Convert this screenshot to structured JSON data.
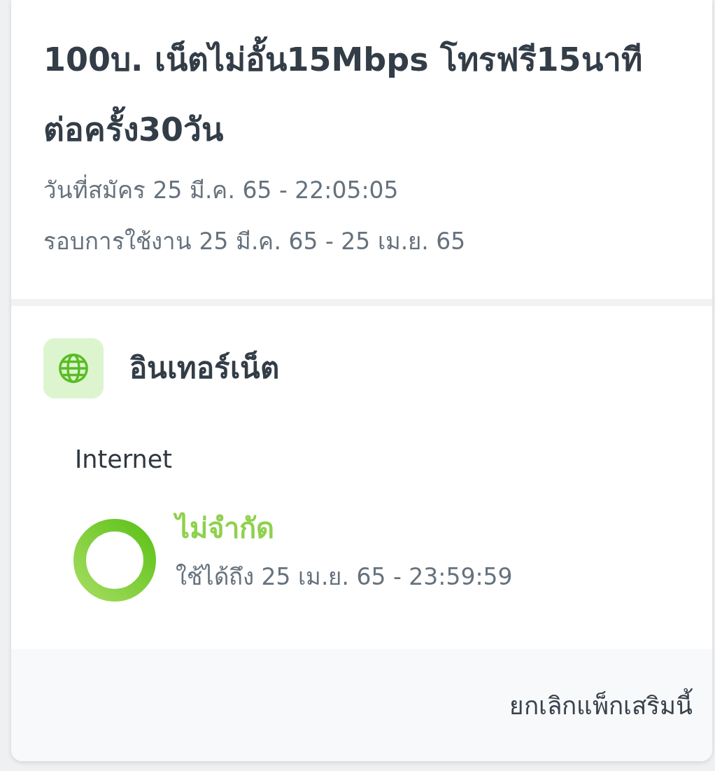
{
  "package": {
    "title": "100บ. เน็ตไม่อั้น15Mbps โทรฟรี15นาทีต่อครั้ง30วัน",
    "details": [
      "วันที่สมัคร 25 มี.ค. 65 - 22:05:05",
      "รอบการใช้งาน 25 มี.ค. 65 - 25 เม.ย. 65"
    ]
  },
  "benefits": [
    {
      "kind": "internet",
      "title": "อินเทอร์เน็ต",
      "label": "Internet",
      "quota": {
        "amount": "ไม่จำกัด",
        "valid_until": "ใช้ได้ถึง 25 เม.ย. 65 - 23:59:59",
        "level": 1
      }
    }
  ],
  "footer": {
    "cancel_link": "ยกเลิกแพ็กเสริมนี้"
  }
}
